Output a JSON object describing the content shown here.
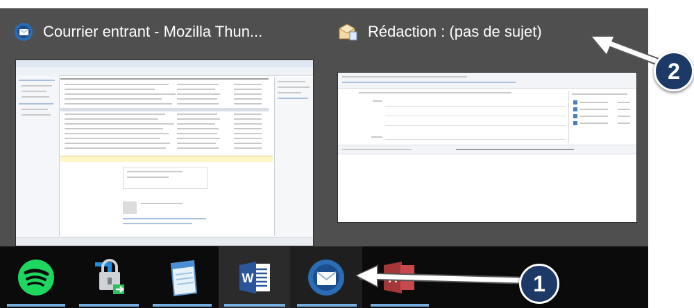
{
  "preview_popup": {
    "thunderbird_window": {
      "title": "Courrier entrant - Mozilla Thun...",
      "icon": "thunderbird-icon"
    },
    "compose_window": {
      "title": "Rédaction : (pas de sujet)",
      "icon": "compose-envelope-icon"
    }
  },
  "taskbar": {
    "items": [
      {
        "name": "Spotify",
        "icon": "spotify-icon"
      },
      {
        "name": "Network lock",
        "icon": "network-lock-icon"
      },
      {
        "name": "Notepad",
        "icon": "notepad-icon"
      },
      {
        "name": "Word",
        "icon": "word-icon"
      },
      {
        "name": "Thunderbird",
        "icon": "thunderbird-icon"
      },
      {
        "name": "Access",
        "icon": "access-icon"
      }
    ]
  },
  "callouts": [
    {
      "number": "1",
      "target": "thunderbird taskbar button"
    },
    {
      "number": "2",
      "target": "compose window preview"
    }
  ],
  "colors": {
    "popup_bg": "#4f4f4f",
    "taskbar_bg": "#0b0b0b",
    "underline": "#77aee0",
    "badge_bg": "#1d3a66"
  }
}
